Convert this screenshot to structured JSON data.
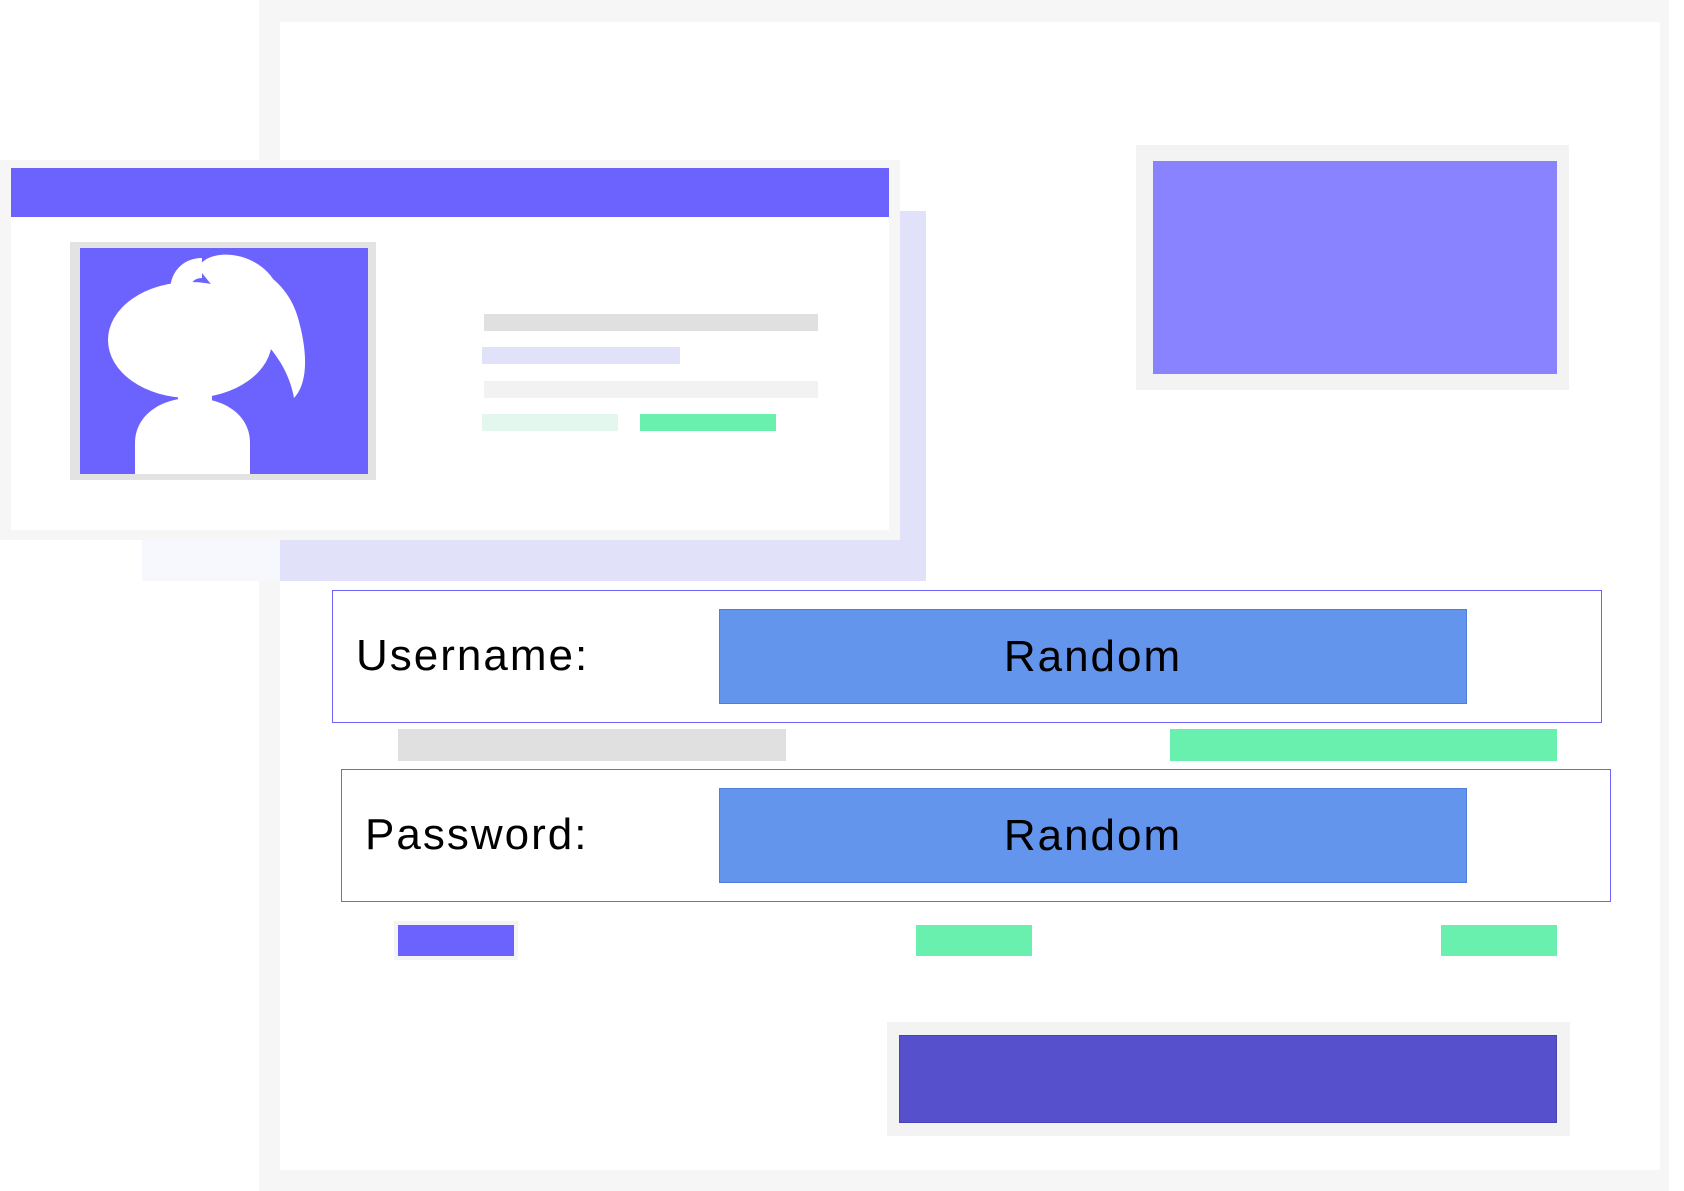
{
  "form": {
    "username": {
      "label": "Username:",
      "value": "Random"
    },
    "password": {
      "label": "Password:",
      "value": "Random"
    }
  },
  "colors": {
    "accent": "#6c63ff",
    "accent_light": "#8983ff",
    "accent_dark": "#5650cc",
    "input_fill": "#6495ed",
    "success": "#69f0ae",
    "muted": "#e0e0e0"
  },
  "icons": {
    "avatar": "user-avatar-icon"
  }
}
